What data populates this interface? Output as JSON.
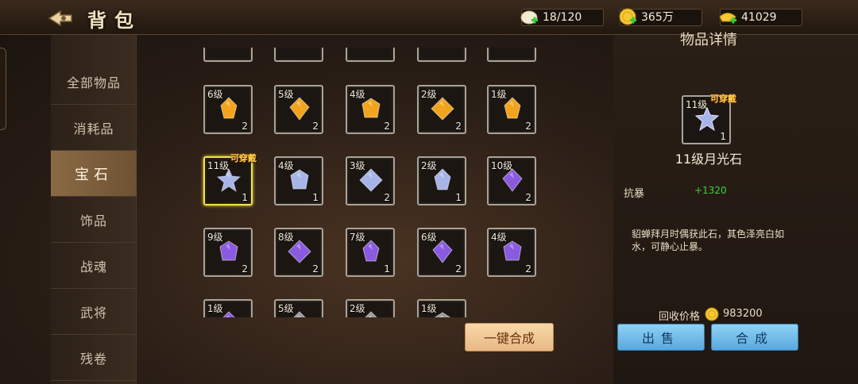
{
  "header": {
    "title": "背包",
    "back_icon": "back-arrow-icon"
  },
  "resources": [
    {
      "name": "bag",
      "icon": "bag-add-icon",
      "value": "18/120"
    },
    {
      "name": "coin",
      "icon": "coin-add-icon",
      "value": "365万"
    },
    {
      "name": "ingot",
      "icon": "ingot-add-icon",
      "value": "41029"
    }
  ],
  "nav": {
    "items": [
      {
        "label": "全部物品",
        "active": false
      },
      {
        "label": "消耗品",
        "active": false
      },
      {
        "label": "宝石",
        "active": true
      },
      {
        "label": "饰品",
        "active": false
      },
      {
        "label": "战魂",
        "active": false
      },
      {
        "label": "武将",
        "active": false
      },
      {
        "label": "残卷",
        "active": false
      }
    ]
  },
  "grid": {
    "rows": [
      [
        {
          "level": "6级",
          "count": "2",
          "color": "#f2a41c"
        },
        {
          "level": "5级",
          "count": "2",
          "color": "#f2a41c"
        },
        {
          "level": "4级",
          "count": "2",
          "color": "#f2a41c"
        },
        {
          "level": "2级",
          "count": "2",
          "color": "#f2a41c"
        },
        {
          "level": "1级",
          "count": "2",
          "color": "#f2a41c"
        }
      ],
      [
        {
          "level": "11级",
          "count": "1",
          "color": "#a6b4e8",
          "wearable": "可穿戴",
          "selected": true
        },
        {
          "level": "4级",
          "count": "1",
          "color": "#a6b4e8"
        },
        {
          "level": "3级",
          "count": "2",
          "color": "#a6b4e8"
        },
        {
          "level": "2级",
          "count": "1",
          "color": "#a6b4e8"
        },
        {
          "level": "10级",
          "count": "2",
          "color": "#8a5ae0"
        }
      ],
      [
        {
          "level": "9级",
          "count": "2",
          "color": "#8a5ae0"
        },
        {
          "level": "8级",
          "count": "2",
          "color": "#8a5ae0"
        },
        {
          "level": "7级",
          "count": "1",
          "color": "#8a5ae0"
        },
        {
          "level": "6级",
          "count": "2",
          "color": "#8a5ae0"
        },
        {
          "level": "4级",
          "count": "2",
          "color": "#8a5ae0"
        }
      ],
      [
        {
          "level": "1级",
          "count": "",
          "color": "#8a5ae0"
        },
        {
          "level": "5级",
          "count": "",
          "color": "#9a9a9a"
        },
        {
          "level": "2级",
          "count": "",
          "color": "#9a9a9a"
        },
        {
          "level": "1级",
          "count": "",
          "color": "#9a9a9a"
        }
      ]
    ]
  },
  "combine_all_label": "一键合成",
  "detail": {
    "title": "物品详情",
    "level": "11级",
    "count": "1",
    "wearable": "可穿戴",
    "name": "11级月光石",
    "stat_label": "抗暴",
    "stat_value": "+1320",
    "description": "貂蝉拜月时偶获此石，其色泽亮白如水，可静心止暴。",
    "price_label": "回收价格",
    "price_value": "983200",
    "sell_label": "出售",
    "combine_label": "合成"
  }
}
